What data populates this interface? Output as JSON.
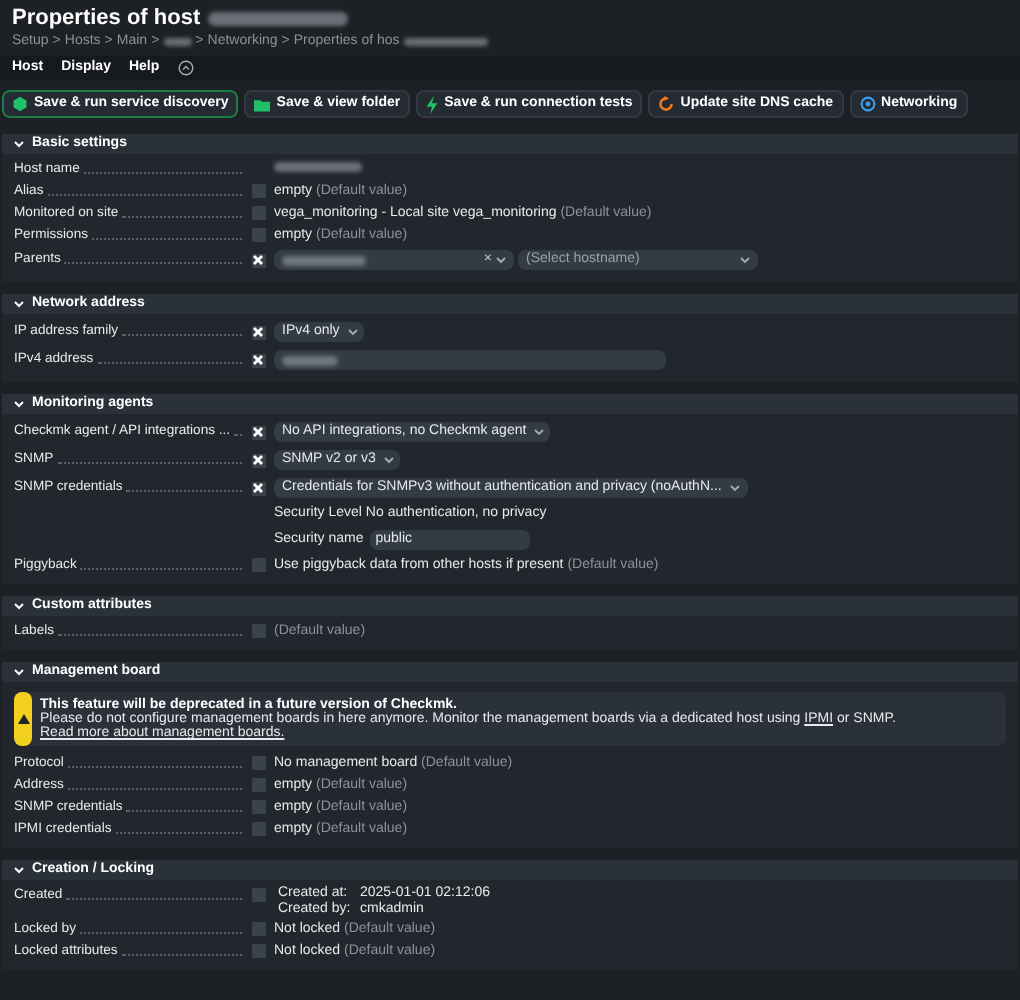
{
  "title": {
    "text": "Properties of host",
    "redacted": true
  },
  "breadcrumb": {
    "separator": ">",
    "items": [
      {
        "label": "Setup"
      },
      {
        "label": "Hosts"
      },
      {
        "label": "Main"
      },
      {
        "redacted": true
      },
      {
        "label": "Networking"
      },
      {
        "label": "Properties of hos",
        "redacted": true
      }
    ]
  },
  "menu": [
    "Host",
    "Display",
    "Help"
  ],
  "buttons": [
    {
      "label": "Save & run service discovery",
      "highlighted": true
    },
    {
      "label": "Save & view folder",
      "highlighted": false
    },
    {
      "label": "Save & run connection tests",
      "highlighted": false
    },
    {
      "label": "Update site DNS cache",
      "highlighted": false
    },
    {
      "label": "Networking",
      "highlighted": false
    }
  ],
  "sections": [
    {
      "title": "Basic settings",
      "expanded": true,
      "rows": [
        {
          "label": "Host name",
          "kind": "redacted"
        },
        {
          "label": "Alias",
          "checked": false,
          "kind": "text",
          "value": "empty",
          "note": "(Default value)"
        },
        {
          "label": "Monitored on site",
          "checked": false,
          "kind": "text",
          "value": "vega_monitoring - Local site vega_monitoring",
          "note": "(Default value)"
        },
        {
          "label": "Permissions",
          "checked": false,
          "kind": "text",
          "value": "empty",
          "note": "(Default value)"
        },
        {
          "label": "Parents",
          "checked": true,
          "kind": "parents",
          "selects": [
            {
              "redacted": true,
              "clear": "×"
            },
            {
              "placeholder": "(Select hostname)"
            }
          ]
        }
      ]
    },
    {
      "title": "Network address",
      "expanded": true,
      "rows": [
        {
          "label": "IP address family",
          "checked": true,
          "kind": "select",
          "value": "IPv4 only"
        },
        {
          "label": "IPv4 address",
          "checked": true,
          "kind": "input",
          "redacted": true
        }
      ]
    },
    {
      "title": "Monitoring agents",
      "expanded": true,
      "rows": [
        {
          "label": "Checkmk agent / API integrations ...",
          "checked": true,
          "kind": "select",
          "value": "No API integrations, no Checkmk agent"
        },
        {
          "label": "SNMP",
          "checked": true,
          "kind": "select",
          "value": "SNMP v2 or v3"
        },
        {
          "label": "SNMP credentials",
          "checked": true,
          "kind": "credentials",
          "value": "Credentials for SNMPv3 without authentication and privacy (noAuthN...",
          "level_label": "Security Level",
          "level_value": "No authentication, no privacy",
          "name_label": "Security name",
          "name_value": "public"
        },
        {
          "label": "Piggyback",
          "checked": false,
          "kind": "text",
          "value": "Use piggyback data from other hosts if present",
          "note": "(Default value)"
        }
      ]
    },
    {
      "title": "Custom attributes",
      "expanded": true,
      "rows": [
        {
          "label": "Labels",
          "checked": false,
          "kind": "text",
          "note": "(Default value)"
        }
      ]
    },
    {
      "title": "Management board",
      "expanded": true,
      "warning": {
        "title": "This feature will be deprecated in a future version of Checkmk.",
        "text": "Please do not configure management boards in here anymore. Monitor the management boards via a dedicated host using",
        "link": "IPMI",
        "text_after": "or SNMP.",
        "more_link": "Read more about management boards."
      },
      "rows": [
        {
          "label": "Protocol",
          "checked": false,
          "kind": "text",
          "value": "No management board",
          "note": "(Default value)"
        },
        {
          "label": "Address",
          "checked": false,
          "kind": "text",
          "value": "empty",
          "note": "(Default value)"
        },
        {
          "label": "SNMP credentials",
          "checked": false,
          "kind": "text",
          "value": "empty",
          "note": "(Default value)"
        },
        {
          "label": "IPMI credentials",
          "checked": false,
          "kind": "text",
          "value": "empty",
          "note": "(Default value)"
        }
      ]
    },
    {
      "title": "Creation / Locking",
      "expanded": true,
      "rows": [
        {
          "label": "Created",
          "checked": false,
          "kind": "created",
          "lines": [
            {
              "key": "Created at:",
              "value": "2025-01-01 02:12:06"
            },
            {
              "key": "Created by:",
              "value": "cmkadmin"
            }
          ]
        },
        {
          "label": "Locked by",
          "checked": false,
          "kind": "text",
          "value": "Not locked",
          "note": "(Default value)"
        },
        {
          "label": "Locked attributes",
          "checked": false,
          "kind": "text",
          "value": "Not locked",
          "note": "(Default value)"
        }
      ]
    }
  ]
}
